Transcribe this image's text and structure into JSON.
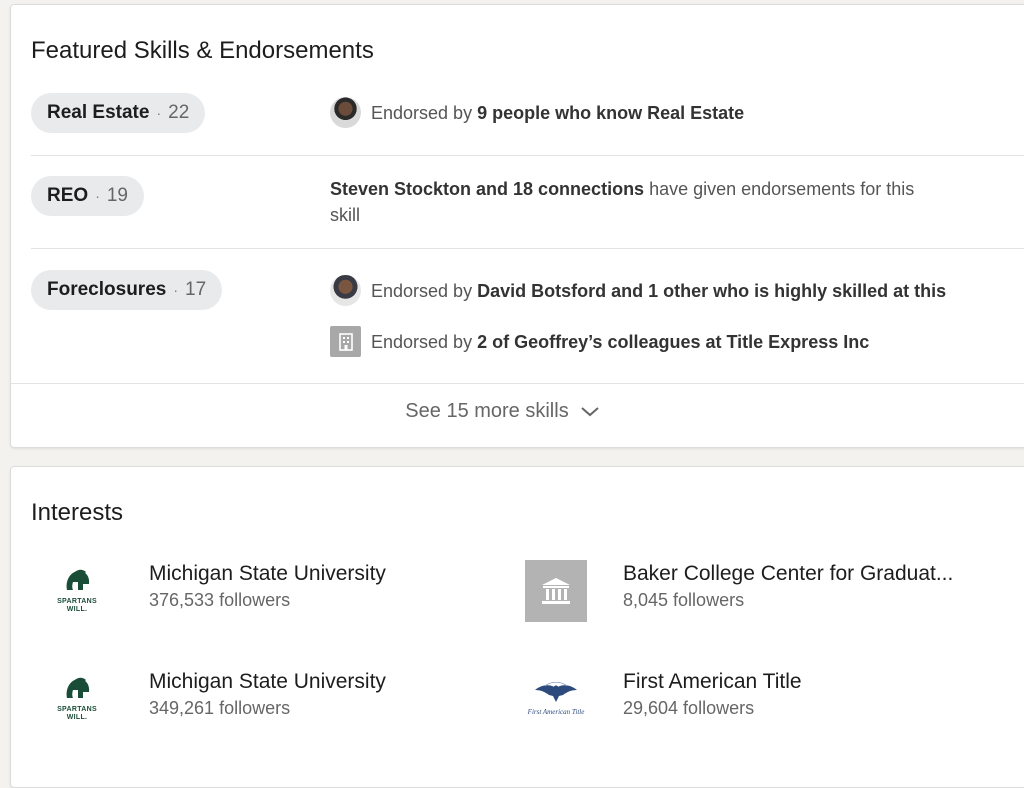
{
  "skills": {
    "title": "Featured Skills & Endorsements",
    "items": [
      {
        "name": "Real Estate",
        "count": "22",
        "endorsements": [
          {
            "prefix": "Endorsed by ",
            "bold": "9 people who know Real Estate",
            "suffix": "",
            "icon": "person-avatar"
          }
        ]
      },
      {
        "name": "REO",
        "count": "19",
        "endorsements": [
          {
            "prefix": "",
            "bold": "Steven Stockton and 18 connections",
            "suffix": " have given endorsements for this skill",
            "icon": "none"
          }
        ]
      },
      {
        "name": "Foreclosures",
        "count": "17",
        "endorsements": [
          {
            "prefix": "Endorsed by ",
            "bold": "David Botsford and 1 other who is highly skilled at this",
            "suffix": "",
            "icon": "person-avatar"
          },
          {
            "prefix": "Endorsed by ",
            "bold": "2 of Geoffrey’s colleagues at Title Express Inc",
            "suffix": "",
            "icon": "company-building-icon"
          }
        ]
      }
    ],
    "see_more_label": "See 15 more skills",
    "separator_dot": "·"
  },
  "interests": {
    "title": "Interests",
    "items": [
      {
        "name": "Michigan State University",
        "followers": "376,533 followers",
        "logo": "spartan-helmet-logo",
        "logo_text_1": "SPARTANS",
        "logo_text_2": "WILL."
      },
      {
        "name": "Baker College Center for Graduat...",
        "followers": "8,045 followers",
        "logo": "building-icon"
      },
      {
        "name": "Michigan State University",
        "followers": "349,261 followers",
        "logo": "spartan-helmet-logo",
        "logo_text_1": "SPARTANS",
        "logo_text_2": "WILL."
      },
      {
        "name": "First American Title",
        "followers": "29,604 followers",
        "logo": "eagle-logo",
        "logo_text_1": "First American Title"
      }
    ]
  },
  "colors": {
    "page_bg": "#f3f2ef",
    "card_bg": "#ffffff",
    "pill_bg": "#e9eaec",
    "msu_green": "#1a4d38",
    "tile_gray": "#b3b3b3"
  }
}
